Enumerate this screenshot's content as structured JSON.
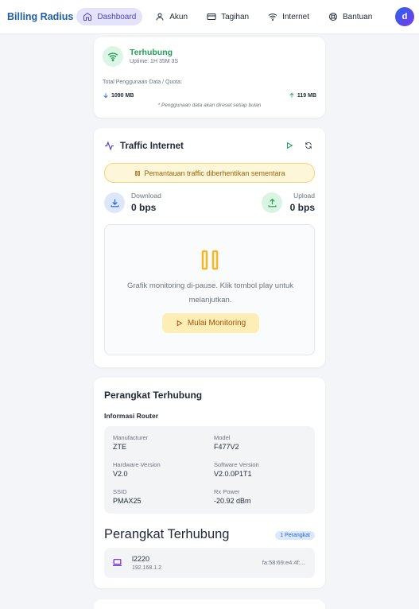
{
  "header": {
    "brand": "Billing Radius",
    "nav": [
      {
        "label": "Dashboard",
        "icon": "home-icon",
        "active": true
      },
      {
        "label": "Akun",
        "icon": "user-icon",
        "active": false
      },
      {
        "label": "Tagihan",
        "icon": "card-icon",
        "active": false
      },
      {
        "label": "Internet",
        "icon": "wifi-icon",
        "active": false
      },
      {
        "label": "Bantuan",
        "icon": "lifebuoy-icon",
        "active": false
      }
    ],
    "avatar_initial": "d"
  },
  "connection": {
    "status": "Terhubung",
    "uptime": "Uptime: 1H 35M 3S",
    "usage_label": "Total Penggunaan Data / Quota:",
    "download": "1090 MB",
    "upload": "119 MB",
    "reset_note": "* Penggunaan data akan direset setiap bulan"
  },
  "traffic": {
    "title": "Traffic Internet",
    "banner": "Pemantauan traffic diberhentikan sementara",
    "download_label": "Download",
    "download_value": "0 bps",
    "upload_label": "Upload",
    "upload_value": "0 bps",
    "paused_message": "Grafik monitoring di-pause. Klik tombol play untuk melanjutkan.",
    "start_button": "Mulai Monitoring"
  },
  "devices": {
    "title": "Perangkat Terhubung",
    "router_info_label": "Informasi Router",
    "router": {
      "manufacturer_label": "Manufacturer",
      "manufacturer": "ZTE",
      "model_label": "Model",
      "model": "F477V2",
      "hw_label": "Hardware Version",
      "hw": "V2.0",
      "sw_label": "Software Version",
      "sw": "V2.0.0P1T1",
      "ssid_label": "SSID",
      "ssid": "PMAX25",
      "rx_label": "Rx Power",
      "rx": "-20.92 dBm"
    },
    "list_title": "Perangkat Terhubung",
    "count_badge": "1 Perangkat",
    "items": [
      {
        "name": "l2220",
        "ip": "192.168.1.2",
        "mac": "fa:58:69:e4:4f:..."
      }
    ]
  },
  "colors": {
    "brand": "#1e5fa8",
    "connected": "#22a05b",
    "accent": "#4f46b5",
    "warning": "#a16207"
  }
}
